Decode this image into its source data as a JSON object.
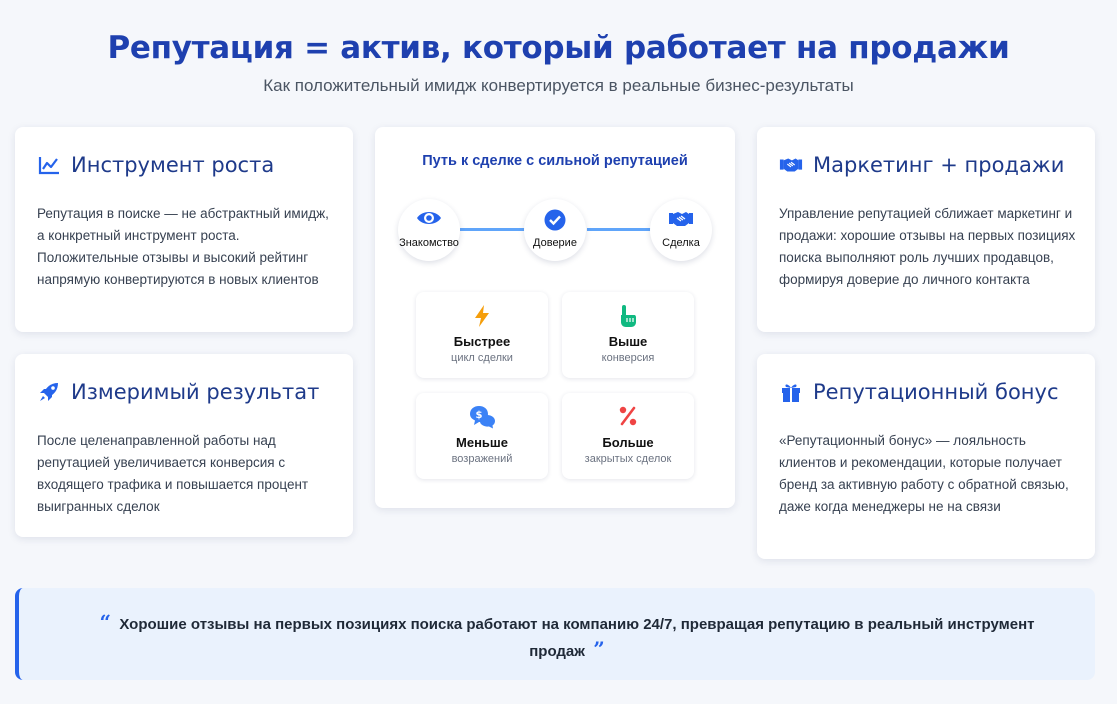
{
  "header": {
    "title": "Репутация = актив, который работает на продажи",
    "subtitle": "Как положительный имидж конвертируется в реальные бизнес-результаты"
  },
  "cards": {
    "growth": {
      "icon": "chart-line-icon",
      "title": "Инструмент роста",
      "text": "Репутация в поиске — не абстрактный имидж, а конкретный инструмент роста. Положительные отзывы и высокий рейтинг напрямую конвертируются в новых клиентов"
    },
    "measurable": {
      "icon": "rocket-icon",
      "title": "Измеримый результат",
      "text": "После целенаправленной работы над репутацией увеличивается конверсия с входящего трафика и повышается процент выигранных сделок"
    },
    "marketing": {
      "icon": "handshake-icon",
      "title": "Маркетинг + продажи",
      "text": "Управление репутацией сближает маркетинг и продажи: хорошие отзывы на первых позициях поиска выполняют роль лучших продавцов, формируя доверие до личного контакта"
    },
    "bonus": {
      "icon": "gift-icon",
      "title": "Репутационный бонус",
      "text": "«Репутационный бонус» — лояльность клиентов и рекомендации, которые получает бренд за активную работу с обратной связью, даже когда менеджеры не на связи"
    }
  },
  "path": {
    "title": "Путь к сделке с сильной репутацией",
    "steps": [
      {
        "label": "Знакомство",
        "icon": "eye-icon"
      },
      {
        "label": "Доверие",
        "icon": "check-circle-icon"
      },
      {
        "label": "Сделка",
        "icon": "handshake-icon"
      }
    ],
    "tiles": [
      {
        "main": "Быстрее",
        "sub": "цикл сделки",
        "icon": "lightning-icon",
        "color": "#f59e0b"
      },
      {
        "main": "Выше",
        "sub": "конверсия",
        "icon": "hand-up-icon",
        "color": "#10b981"
      },
      {
        "main": "Меньше",
        "sub": "возражений",
        "icon": "comments-dollar-icon",
        "color": "#3b82f6"
      },
      {
        "main": "Больше",
        "sub": "закрытых сделок",
        "icon": "percent-icon",
        "color": "#ef4444"
      }
    ]
  },
  "quote": {
    "text": "Хорошие отзывы на первых позициях поиска работают на компанию 24/7, превращая репутацию в реальный инструмент продаж"
  },
  "colors": {
    "accent": "#1e40af",
    "link": "#2563eb",
    "connector": "#60a5fa"
  }
}
